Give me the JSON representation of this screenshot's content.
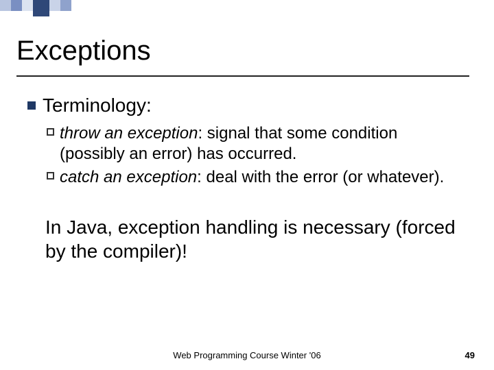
{
  "deco_colors": [
    "#b8c5e0",
    "#7a8fc2",
    "#dce3f0",
    "#2f4878",
    "#c9d3e8",
    "#8fa2cc"
  ],
  "title": "Exceptions",
  "list": {
    "heading": "Terminology:",
    "items": [
      {
        "term": "throw",
        "rest": " an exception",
        "after": ": signal that some condition (possibly an error) has occurred."
      },
      {
        "term": "catch",
        "rest": " an exception",
        "after": ": deal with the error (or whatever)."
      }
    ]
  },
  "summary": "In Java, exception handling is necessary (forced by the compiler)!",
  "footer": "Web Programming Course Winter '06",
  "page_number": "49"
}
